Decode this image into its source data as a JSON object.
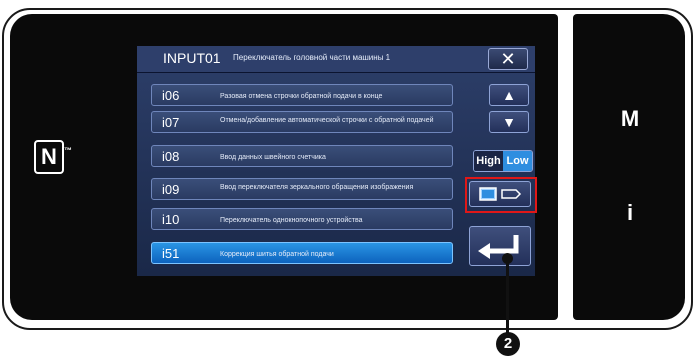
{
  "panel": {
    "side_buttons": {
      "m_label": "M",
      "i_label": "i"
    },
    "nfc_trademark": "™"
  },
  "screen": {
    "title_code": "INPUT01",
    "title_text": "Переключатель головной части машины 1",
    "close_label": "✕",
    "rows": [
      {
        "code": "i06",
        "desc": "Разовая отмена строчки обратной подачи в конце"
      },
      {
        "code": "i07",
        "desc": "Отмена/добавление автоматической строчки с обратной подачей"
      },
      {
        "code": "i08",
        "desc": "Ввод данных швейного счетчика"
      },
      {
        "code": "i09",
        "desc": "Ввод переключателя зеркального обращения изображения"
      },
      {
        "code": "i10",
        "desc": "Переключатель однокнопочного устройства"
      },
      {
        "code": "i51",
        "desc": "Коррекция шитья обратной подачи"
      }
    ],
    "selected_row": 5,
    "scroll_up_label": "▲",
    "scroll_down_label": "▼",
    "high_label": "High",
    "low_label": "Low",
    "highlight_color": "#2f8ee0"
  },
  "callout": {
    "label": "2"
  }
}
